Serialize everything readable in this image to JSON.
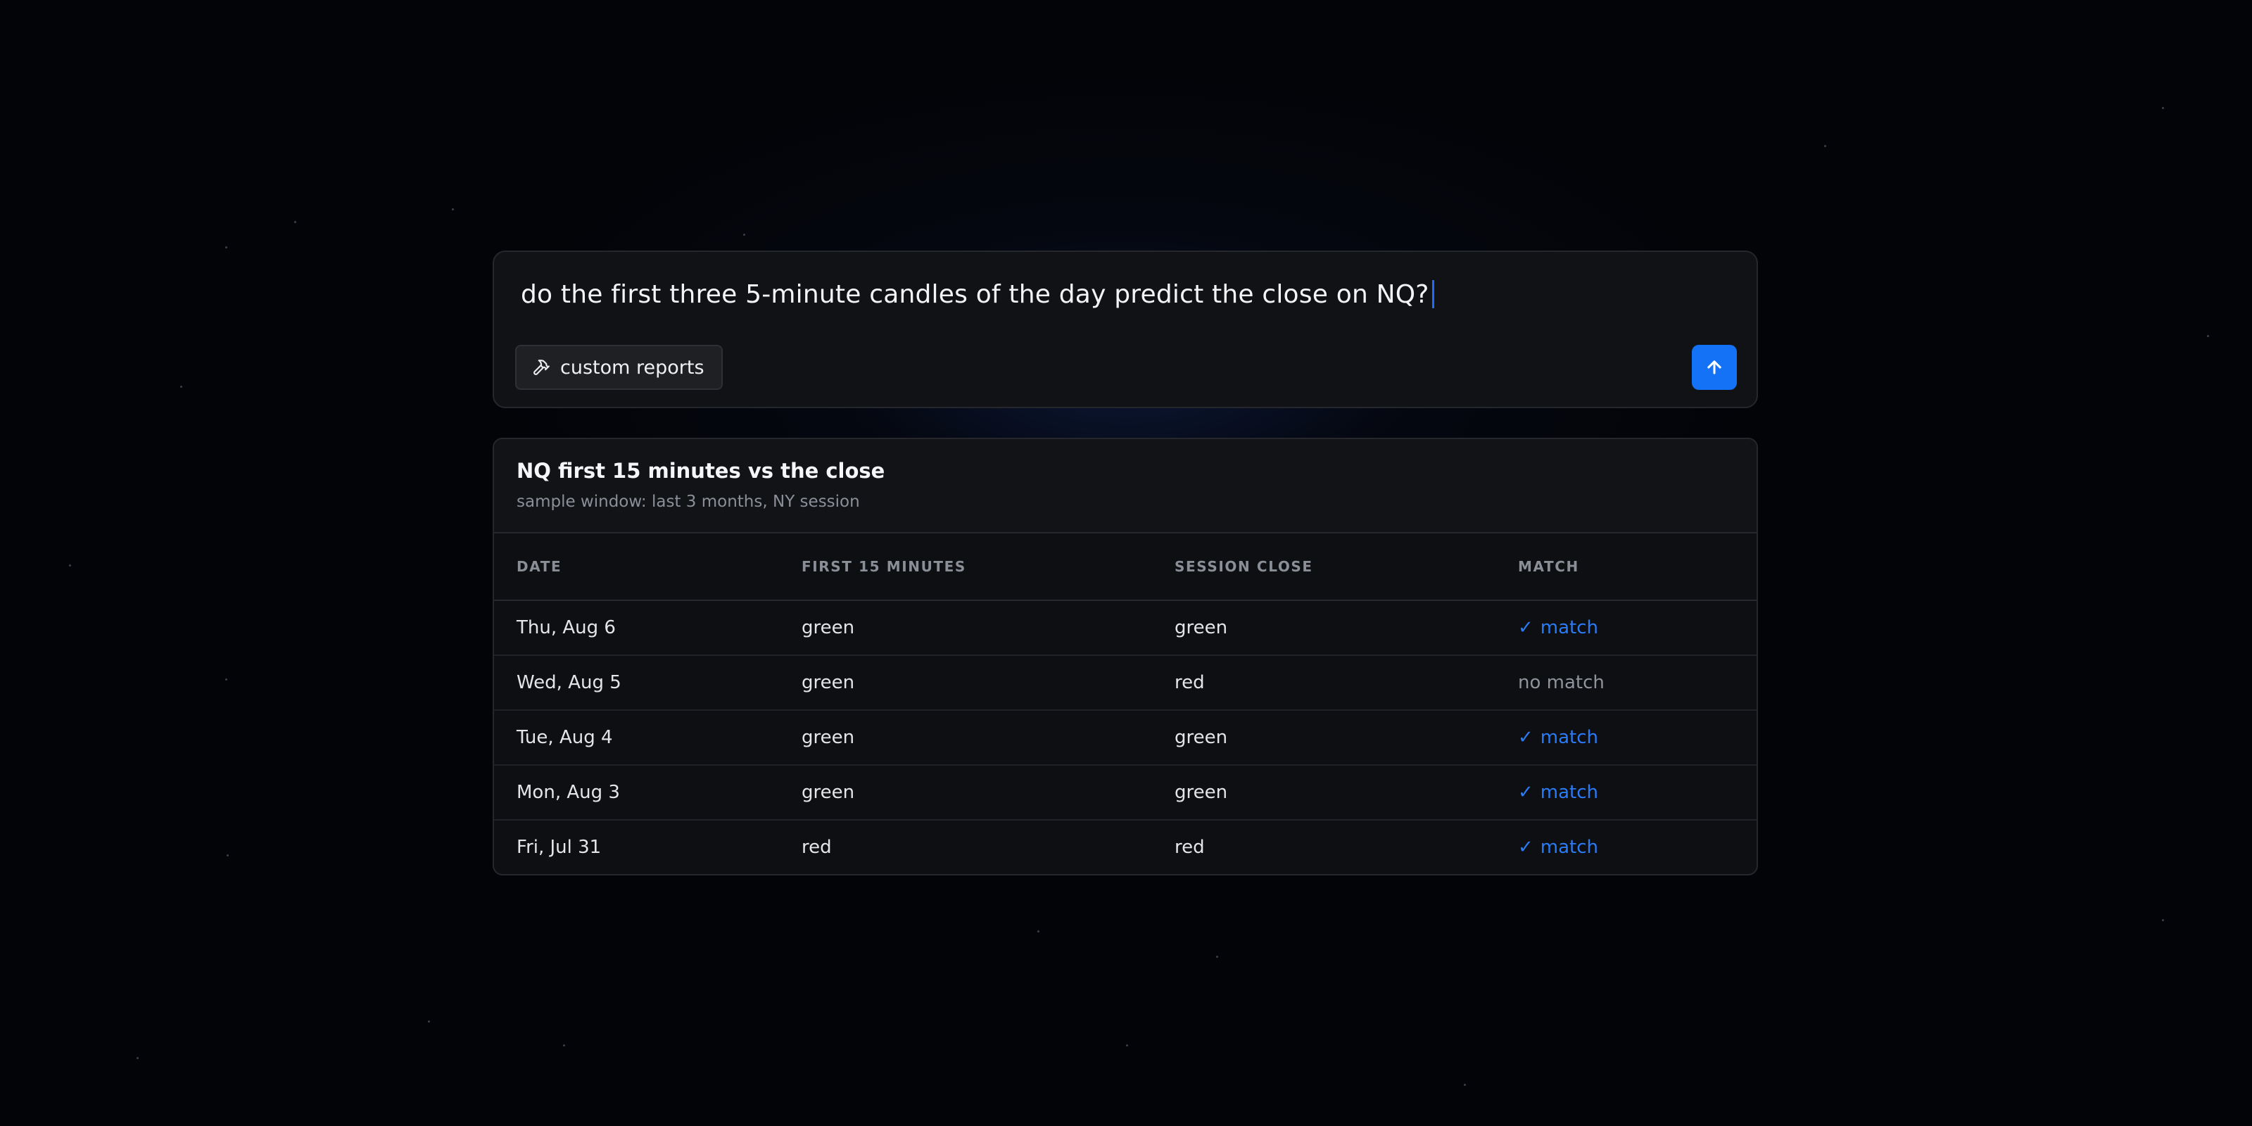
{
  "prompt": {
    "query": "do the first three 5-minute candles of the day predict the close on NQ?",
    "tool_chip_label": "custom reports",
    "tool_chip_icon": "hammer-icon",
    "send_icon": "arrow-up-icon",
    "accent_color": "#1372f5"
  },
  "result": {
    "title": "NQ first 15 minutes vs the close",
    "subtitle": "sample window: last 3 months, NY session",
    "columns": [
      "DATE",
      "FIRST 15 MINUTES",
      "SESSION CLOSE",
      "MATCH"
    ],
    "rows": [
      {
        "date": "Thu, Aug 6",
        "first15": "green",
        "close": "green",
        "match": "match",
        "is_match": true
      },
      {
        "date": "Wed, Aug 5",
        "first15": "green",
        "close": "red",
        "match": "no match",
        "is_match": false
      },
      {
        "date": "Tue, Aug 4",
        "first15": "green",
        "close": "green",
        "match": "match",
        "is_match": true
      },
      {
        "date": "Mon, Aug 3",
        "first15": "green",
        "close": "green",
        "match": "match",
        "is_match": true
      },
      {
        "date": "Fri, Jul 31",
        "first15": "red",
        "close": "red",
        "match": "match",
        "is_match": true
      }
    ],
    "check_symbol": "✓",
    "match_color": "#2a7cf6",
    "no_match_color": "#8f939b"
  }
}
